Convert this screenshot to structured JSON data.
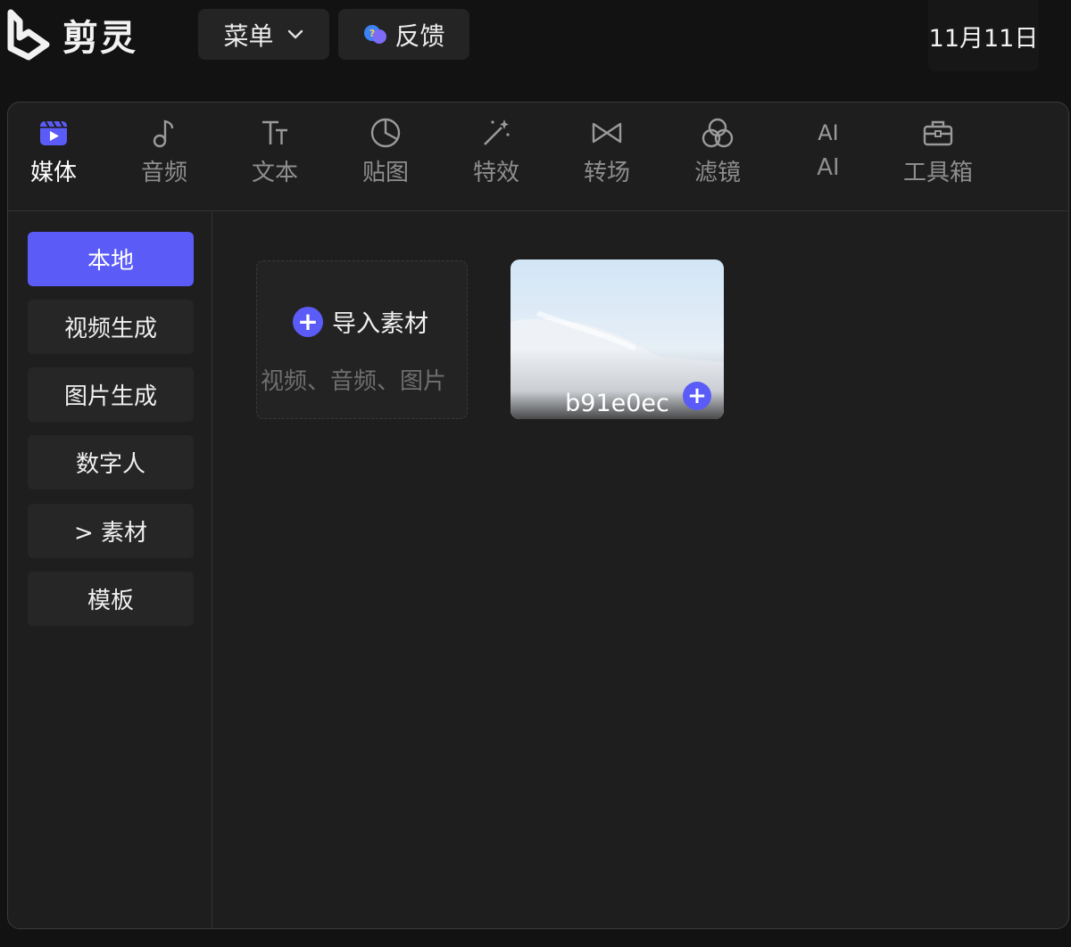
{
  "app": {
    "name": "剪灵",
    "logo_icon": "jianling-logo-icon"
  },
  "topbar": {
    "menu_label": "菜单",
    "feedback_label": "反馈",
    "date": "11月11日"
  },
  "tabs": [
    {
      "label": "媒体",
      "icon": "media-icon",
      "active": true
    },
    {
      "label": "音频",
      "icon": "music-note-icon"
    },
    {
      "label": "文本",
      "icon": "text-icon"
    },
    {
      "label": "贴图",
      "icon": "sticker-icon"
    },
    {
      "label": "特效",
      "icon": "magic-wand-icon"
    },
    {
      "label": "转场",
      "icon": "transition-icon"
    },
    {
      "label": "滤镜",
      "icon": "filter-icon"
    },
    {
      "label": "AI",
      "icon_text": "AI",
      "icon": "ai-icon"
    },
    {
      "label": "工具箱",
      "icon": "toolbox-icon"
    }
  ],
  "sidebar": {
    "items": [
      {
        "label": "本地",
        "active": true
      },
      {
        "label": "视频生成"
      },
      {
        "label": "图片生成"
      },
      {
        "label": "数字人"
      },
      {
        "label": "> 素材"
      },
      {
        "label": "模板"
      }
    ]
  },
  "media": {
    "import_title": "导入素材",
    "import_subtitle": "视频、音频、图片",
    "items": [
      {
        "name": "b91e0ec"
      }
    ]
  },
  "colors": {
    "accent": "#5b5bf7",
    "background": "#121212",
    "panel": "#1e1e1e"
  }
}
